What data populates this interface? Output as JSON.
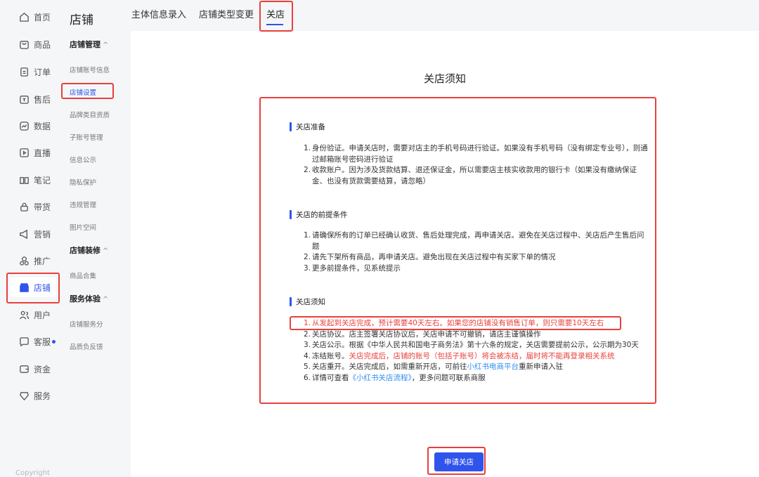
{
  "rail": {
    "items": [
      {
        "label": "首页",
        "icon": "home-icon"
      },
      {
        "label": "商品",
        "icon": "product-icon"
      },
      {
        "label": "订单",
        "icon": "order-icon"
      },
      {
        "label": "售后",
        "icon": "after-sales-icon"
      },
      {
        "label": "数据",
        "icon": "data-icon"
      },
      {
        "label": "直播",
        "icon": "live-icon"
      },
      {
        "label": "笔记",
        "icon": "notes-icon"
      },
      {
        "label": "带货",
        "icon": "lock-icon"
      },
      {
        "label": "营销",
        "icon": "megaphone-icon"
      },
      {
        "label": "推广",
        "icon": "promote-icon"
      },
      {
        "label": "店铺",
        "icon": "store-icon"
      },
      {
        "label": "用户",
        "icon": "users-icon"
      },
      {
        "label": "客服",
        "icon": "chat-icon"
      },
      {
        "label": "资金",
        "icon": "wallet-icon"
      },
      {
        "label": "服务",
        "icon": "service-icon"
      }
    ],
    "copyright": "Copyright"
  },
  "subnav": {
    "title": "店铺",
    "group_manage": "店铺管理",
    "manage_items": [
      "店铺账号信息",
      "店铺设置",
      "品牌类目资质",
      "子账号管理",
      "信息公示",
      "隐私保护",
      "违规管理",
      "图片空间"
    ],
    "group_decor": "店铺装修",
    "decor_items": [
      "商品合集"
    ],
    "group_service": "服务体验",
    "service_items": [
      "店铺服务分",
      "品质负反馈"
    ],
    "caret": "^"
  },
  "tabs": [
    "主体信息录入",
    "店铺类型变更",
    "关店"
  ],
  "main": {
    "title": "关店须知",
    "sections": {
      "prep": {
        "title": "关店准备",
        "items": [
          "身份验证。申请关店时，需要对店主的手机号码进行验证。如果没有手机号码（没有绑定专业号），则通过邮箱账号密码进行验证",
          "收款账户。因为涉及货款结算、退还保证金，所以需要店主核实收款用的银行卡（如果没有缴纳保证金、也没有货款需要结算，请忽略）"
        ]
      },
      "pre": {
        "title": "关店的前提条件",
        "items": [
          "请确保所有的订单已经确认收货、售后处理完成，再申请关店。避免在关店过程中、关店后产生售后问题",
          "请先下架所有商品，再申请关店。避免出现在关店过程中有买家下单的情况",
          "更多前提条件，见系统提示"
        ]
      },
      "notice": {
        "title": "关店须知",
        "item1": "从发起到关店完成，预计需要40天左右。如果您的店铺没有销售订单，则只需要10天左右",
        "item2": "关店协议。店主签署关店协议后，关店申请不可撤销，请店主谨慎操作",
        "item3": "关店公示。根据《中华人民共和国电子商务法》第十六条的规定，关店需要提前公示，公示期为30天",
        "item4_prefix": "冻结账号。",
        "item4_red": "关店完成后，店铺的账号（包括子账号）将会被冻结，届时将不能再登录相关系统",
        "item5_prefix": "关店重开。关店完成后，如需重新开店，可前往",
        "item5_link": "小红书电商平台",
        "item5_suffix": "重新申请入驻",
        "item6_prefix": "详情可查看",
        "item6_link": "《小红书关店流程》",
        "item6_suffix": "，更多问题可联系商服"
      }
    },
    "apply_button": "申请关店"
  },
  "colors": {
    "accent": "#2f54eb",
    "highlight": "#e8403c",
    "link": "#2f8cf0"
  }
}
